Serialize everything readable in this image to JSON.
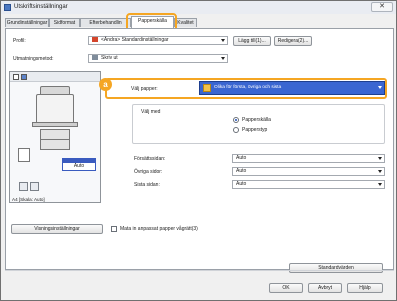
{
  "window": {
    "title": "Utskriftsinställningar",
    "close_glyph": "✕"
  },
  "tabs": [
    {
      "label": "Grundinställningar"
    },
    {
      "label": "Sidformat"
    },
    {
      "label": "Efterbehandlin"
    },
    {
      "label": "Papperskälla"
    },
    {
      "label": "Kvalitet"
    }
  ],
  "profile": {
    "label": "Profil:",
    "value": "<Ändra> Standardinställningar",
    "add_label": "Lägg till(1)...",
    "edit_label": "Redigera(2)..."
  },
  "output": {
    "label": "Utmatningsmetod:",
    "value": "Skriv ut"
  },
  "preview": {
    "auto_label": "Auto",
    "caption": "A4 [Skala: Auto]"
  },
  "paper": {
    "badge": "a",
    "label": "Välj papper:",
    "value": "Olika för första, övriga och sista",
    "select_by_label": "Välj med",
    "radio_source": "Papperskälla",
    "radio_type": "Papperstyp"
  },
  "sides": [
    {
      "label": "Försättssidan:",
      "value": "Auto"
    },
    {
      "label": "Övriga sidor:",
      "value": "Auto"
    },
    {
      "label": "Sista sidan:",
      "value": "Auto"
    }
  ],
  "footer": {
    "printer_settings": "Visningsinställningar",
    "custom_paper_check": "Mata in anpassat papper vågrätt(3)",
    "defaults_button": "Standardvärden",
    "ok": "OK",
    "cancel": "Avbryt",
    "help": "Hjälp"
  },
  "colors": {
    "accent": "#f5a623",
    "selection": "#3a66d1",
    "auto_blue": "#3a5bbf"
  }
}
